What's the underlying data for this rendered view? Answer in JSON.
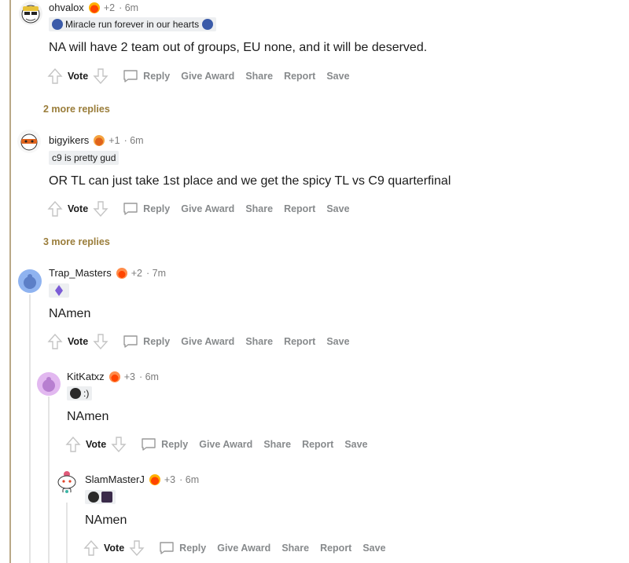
{
  "action_labels": {
    "vote": "Vote",
    "reply": "Reply",
    "give_award": "Give Award",
    "share": "Share",
    "report": "Report",
    "save": "Save"
  },
  "comments": [
    {
      "username": "ohvalox",
      "awards": "+2",
      "time": "· 6m",
      "flair": "Miracle run forever in our hearts",
      "body": "NA will have 2 team out of groups, EU none, and it will be deserved."
    },
    {
      "username": "bigyikers",
      "awards": "+1",
      "time": "· 6m",
      "flair": "c9 is pretty gud",
      "body": "OR TL can just take 1st place and we get the spicy TL vs C9 quarterfinal"
    },
    {
      "username": "Trap_Masters",
      "awards": "+2",
      "time": "· 7m",
      "flair": "",
      "body": "NAmen"
    },
    {
      "username": "KitKatxz",
      "awards": "+3",
      "time": "· 6m",
      "flair": ":)",
      "body": "NAmen"
    },
    {
      "username": "SlamMasterJ",
      "awards": "+3",
      "time": "· 6m",
      "flair": "",
      "body": "NAmen"
    }
  ],
  "more_replies": [
    "2 more replies",
    "3 more replies"
  ],
  "colors": {
    "accent_gold": "#9a7d3a",
    "action_gray": "#878a8c",
    "flair_bg": "#edeff1"
  }
}
